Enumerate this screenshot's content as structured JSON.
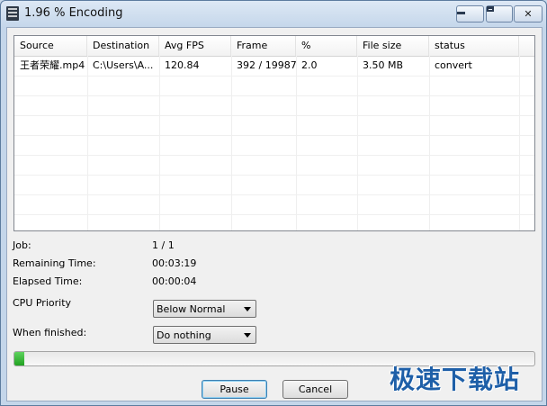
{
  "window": {
    "title": "1.96 % Encoding",
    "controls": [
      "minimize",
      "maximize",
      "close"
    ]
  },
  "table": {
    "columns": [
      "Source",
      "Destination",
      "Avg FPS",
      "Frame",
      "%",
      "File size",
      "status"
    ],
    "rows": [
      [
        "王者荣耀.mp4",
        "C:\\Users\\A...",
        "120.84",
        "392 / 19987",
        "2.0",
        "3.50 MB",
        "convert"
      ]
    ]
  },
  "info": {
    "job_label": "Job:",
    "job_value": "1 / 1",
    "remaining_label": "Remaining Time:",
    "remaining_value": "00:03:19",
    "elapsed_label": "Elapsed Time:",
    "elapsed_value": "00:00:04"
  },
  "cpu_priority": {
    "label": "CPU Priority",
    "value": "Below Normal"
  },
  "when_finished": {
    "label": "When finished:",
    "value": "Do nothing"
  },
  "progress": {
    "percent": 1.96
  },
  "buttons": {
    "pause": "Pause",
    "cancel": "Cancel"
  },
  "watermark": "极速下载站",
  "icons": {
    "app": "film-strip-icon",
    "dropdown": "chevron-down-icon"
  }
}
